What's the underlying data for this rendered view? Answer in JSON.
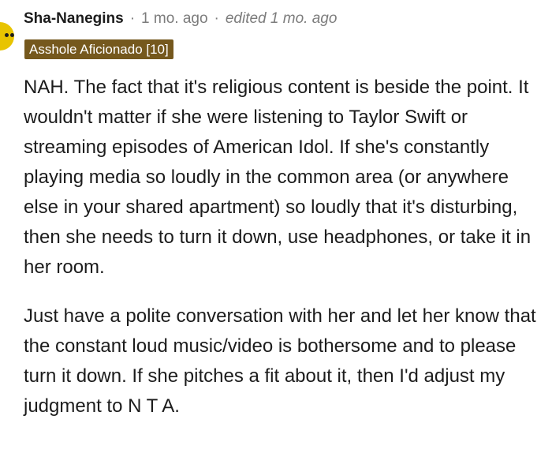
{
  "comment": {
    "username": "Sha-Nanegins",
    "separator": "·",
    "posted": "1 mo. ago",
    "edited": "edited 1 mo. ago",
    "flair": "Asshole Aficionado [10]",
    "paragraphs": [
      "NAH. The fact that it's religious content is beside the point. It wouldn't matter if she were listening to Taylor Swift or streaming episodes of American Idol. If she's constantly playing media so loudly in the common area (or anywhere else in your shared apartment) so loudly that it's disturbing, then she needs to turn it down, use headphones, or take it in her room.",
      "Just have a polite conversation with her and let her know that the constant loud music/video is bothersome and to please turn it down. If she pitches a fit about it, then I'd adjust my judgment to N T A."
    ]
  },
  "colors": {
    "flair_bg": "#75581d",
    "avatar": "#e8c400",
    "meta": "#7c7c7c"
  }
}
